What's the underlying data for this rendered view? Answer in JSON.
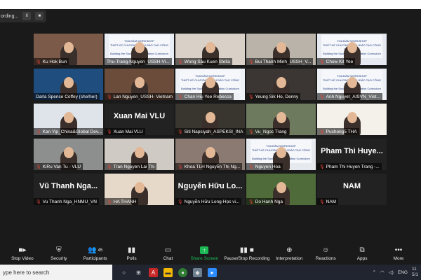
{
  "recording": {
    "text": "ording...",
    "pause": "II",
    "stop": "■"
  },
  "participants": [
    {
      "name": "Ku Hok Bun",
      "muted": true,
      "kind": "video",
      "bg": "#7b5a4a"
    },
    {
      "name": "Thu-Trang-Nguyen_USSH-Vi...",
      "muted": false,
      "kind": "video",
      "bg": "#e8eef3",
      "active": true
    },
    {
      "name": "Wong Sau Kuen Stella",
      "muted": true,
      "kind": "video",
      "bg": "#d9d1c8"
    },
    {
      "name": "Bui Thanh Minh_USSH_V...",
      "muted": true,
      "kind": "video",
      "bg": "#b9b3aa"
    },
    {
      "name": "Chow Kit Yee",
      "muted": true,
      "kind": "video",
      "bg": "#e6eaf0"
    },
    {
      "name": "Darla Spence Coffey (she/her)",
      "muted": false,
      "kind": "video",
      "bg": "#1f4d7e"
    },
    {
      "name": "Lan Nguyen_USSH- Vietnam",
      "muted": true,
      "kind": "video",
      "bg": "#6b4c3b"
    },
    {
      "name": "Chan Hiu Yee Rebecca",
      "muted": true,
      "kind": "video",
      "bg": "#eef1f5"
    },
    {
      "name": "Yeung Sik Ho, Denny",
      "muted": true,
      "kind": "video",
      "bg": "#3b3633"
    },
    {
      "name": "Anh Nguyet_AISVN_Viet...",
      "muted": true,
      "kind": "video",
      "bg": "#edf0f4"
    },
    {
      "name": "Kan Yip_China&Global Dev...",
      "muted": true,
      "kind": "video",
      "bg": "#dfe4ea"
    },
    {
      "name": "Xuan Mai VLU",
      "muted": true,
      "kind": "name",
      "big": "Xuan Mai VLU"
    },
    {
      "name": "Siti Napsiyah_ASPEKSI_INA",
      "muted": true,
      "kind": "video",
      "bg": "#39352f"
    },
    {
      "name": "Vu_Ngoc Trang",
      "muted": true,
      "kind": "video",
      "bg": "#6d7a5e"
    },
    {
      "name": "Puchong5 THA",
      "muted": true,
      "kind": "video",
      "bg": "#f4f1ea"
    },
    {
      "name": "KiRu Van Tu - VLU",
      "muted": true,
      "kind": "video",
      "bg": "#8c8f8d"
    },
    {
      "name": "Tran Nguyen Lai Thi",
      "muted": true,
      "kind": "video",
      "bg": "#cfcac4"
    },
    {
      "name": "Khoa TLH Nguyễn Thị Ng...",
      "muted": true,
      "kind": "video",
      "bg": "#8a7a72"
    },
    {
      "name": "Nguyen Hoa",
      "muted": true,
      "kind": "video",
      "bg": "#e6e9ee"
    },
    {
      "name": "Pham Thi Huyen Trang -...",
      "muted": true,
      "kind": "name",
      "big": "Pham Thi Huye..."
    },
    {
      "name": "Vu Thanh Nga_HNMU_VN",
      "muted": true,
      "kind": "name",
      "big": "Vũ Thanh Nga..."
    },
    {
      "name": "HA THANH",
      "muted": true,
      "kind": "video",
      "bg": "#e7d9c9"
    },
    {
      "name": "Nguyễn Hữu Long-Học vi...",
      "muted": true,
      "kind": "name",
      "big": "Nguyễn Hữu Lo..."
    },
    {
      "name": "Do Hanh Nga",
      "muted": true,
      "kind": "video",
      "bg": "#4f6b3a"
    },
    {
      "name": "NAM",
      "muted": true,
      "kind": "name",
      "big": "NAM"
    }
  ],
  "slide_text": {
    "l1": "TỌA ĐÀM WORKSHOP",
    "l2": "THIẾT KẾ CHƯƠNG TRÌNH ĐÀO TẠO CÔNG TÁC XÃ HỘI",
    "l3": "Building the Social Work Education Curriculum"
  },
  "toolbar": {
    "stop_video": "Stop Video",
    "security": "Security",
    "participants": "Participants",
    "participants_count": "45",
    "polls": "Polls",
    "chat": "Chat",
    "share_screen": "Share Screen",
    "pause_recording": "Pause/Stop Recording",
    "interpretation": "Interpretation",
    "reactions": "Reactions",
    "apps": "Apps",
    "more": "More"
  },
  "taskbar": {
    "search": "ype here to search",
    "lang": "ENG",
    "time": "11",
    "date": "5/1"
  },
  "colors": {
    "active_border": "#a4e24f",
    "share_green": "#1db954",
    "muted_red": "#e0453a"
  }
}
